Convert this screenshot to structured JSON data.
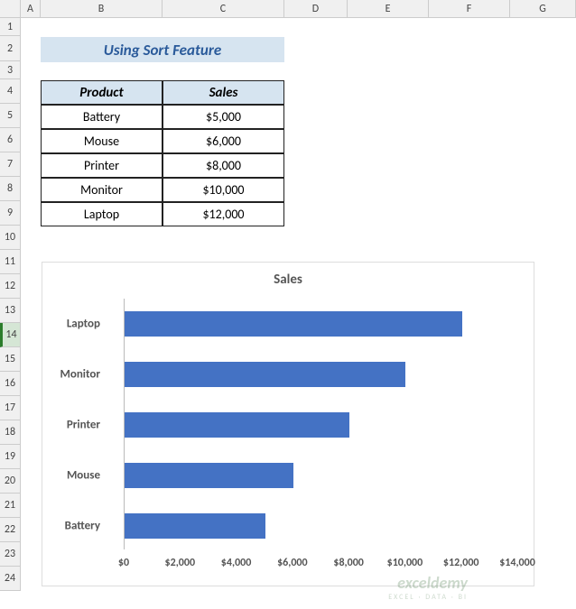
{
  "columns": [
    "A",
    "B",
    "C",
    "D",
    "E",
    "F",
    "G"
  ],
  "row_count": 24,
  "selected_row": 14,
  "title": "Using Sort Feature",
  "table": {
    "headers": {
      "product": "Product",
      "sales": "Sales"
    },
    "rows": [
      {
        "product": "Battery",
        "sales": "$5,000"
      },
      {
        "product": "Mouse",
        "sales": "$6,000"
      },
      {
        "product": "Printer",
        "sales": "$8,000"
      },
      {
        "product": "Monitor",
        "sales": "$10,000"
      },
      {
        "product": "Laptop",
        "sales": "$12,000"
      }
    ]
  },
  "chart_data": {
    "type": "bar",
    "orientation": "horizontal",
    "title": "Sales",
    "xlabel": "",
    "ylabel": "",
    "categories": [
      "Laptop",
      "Monitor",
      "Printer",
      "Mouse",
      "Battery"
    ],
    "values": [
      12000,
      10000,
      8000,
      6000,
      5000
    ],
    "xlim": [
      0,
      14000
    ],
    "x_ticks": [
      "$0",
      "$2,000",
      "$4,000",
      "$6,000",
      "$8,000",
      "$10,000",
      "$12,000",
      "$14,000"
    ],
    "bar_color": "#4472c4"
  },
  "watermark": {
    "brand": "exceldemy",
    "tagline": "EXCEL · DATA · BI"
  }
}
